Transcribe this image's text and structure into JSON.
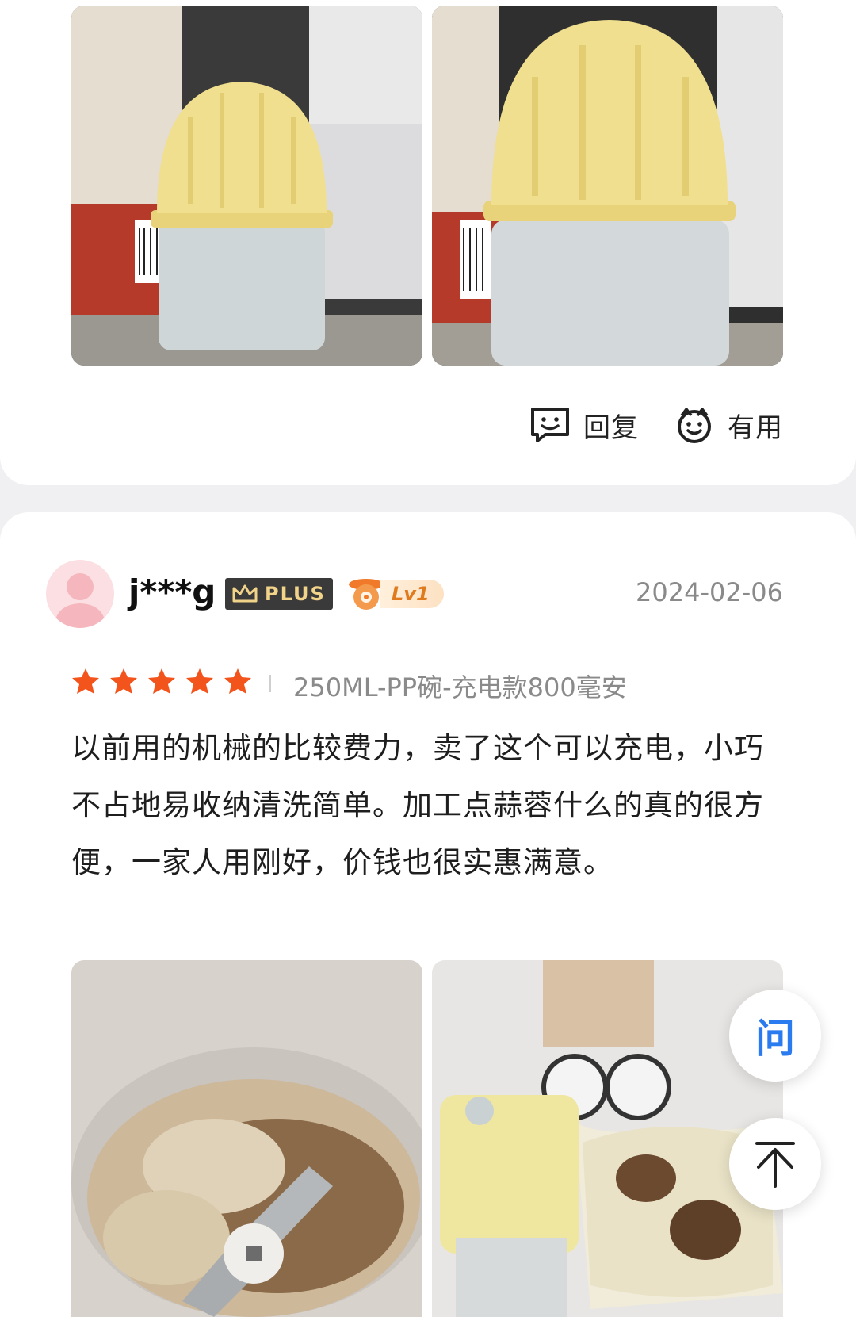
{
  "review1": {
    "actions": {
      "reply_label": "回复",
      "useful_label": "有用"
    }
  },
  "review2": {
    "username": "j***g",
    "plus_label": "PLUS",
    "level_label": "Lv1",
    "date": "2024-02-06",
    "rating": 5,
    "variant": "250ML-PP碗-充电款800毫安",
    "text": "以前用的机械的比较费力，卖了这个可以充电，小巧不占地易收纳清洗简单。加工点蒜蓉什么的真的很方便，一家人用刚好，价钱也很实惠满意。"
  },
  "floating": {
    "ask_label": "问"
  },
  "colors": {
    "star": "#f2541b",
    "ask": "#2a7af0",
    "plus_bg": "#3a3a3a",
    "plus_text": "#f2d38a"
  }
}
